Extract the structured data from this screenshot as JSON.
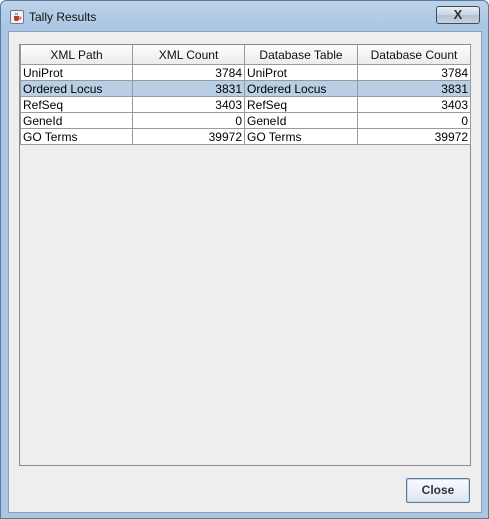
{
  "window": {
    "title": "Tally Results",
    "close_glyph": "X",
    "icon": "java-cup-icon"
  },
  "table": {
    "columns": [
      "XML Path",
      "XML Count",
      "Database Table",
      "Database Count"
    ],
    "selected_row": 1,
    "rows": [
      [
        "UniProt",
        "3784",
        "UniProt",
        "3784"
      ],
      [
        "Ordered Locus",
        "3831",
        "Ordered Locus",
        "3831"
      ],
      [
        "RefSeq",
        "3403",
        "RefSeq",
        "3403"
      ],
      [
        "GeneId",
        "0",
        "GeneId",
        "0"
      ],
      [
        "GO Terms",
        "39972",
        "GO Terms",
        "39972"
      ]
    ]
  },
  "buttons": {
    "close_label": "Close"
  },
  "colors": {
    "selection": "#b8cfe5",
    "frame": "#a9c6e3"
  }
}
